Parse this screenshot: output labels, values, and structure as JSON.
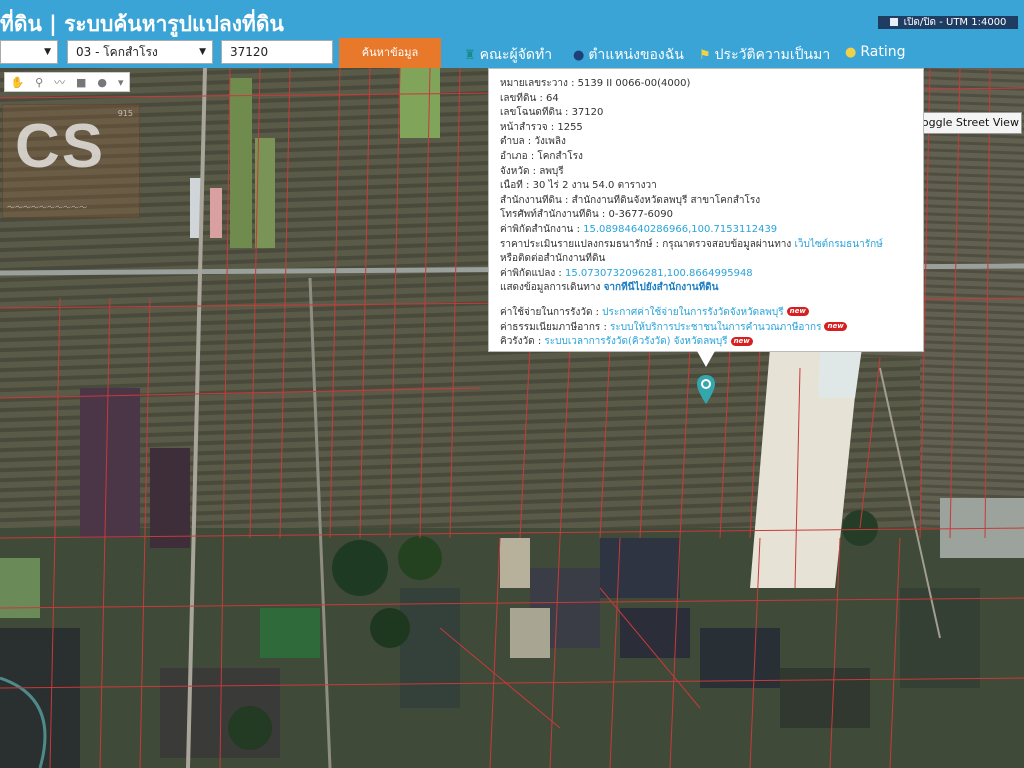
{
  "header": {
    "title": "ที่ดิน | ระบบค้นหารูปแปลงที่ดิน",
    "utm_toggle": "เปิด/ปิด - UTM 1:4000"
  },
  "search": {
    "province_value": "",
    "district_value": "03 - โคกสำโรง",
    "parcel_value": "37120",
    "button_label": "ค้นหาข้อมูล"
  },
  "nav": {
    "team": "คณะผู้จัดทำ",
    "location": "ตำแหน่งของฉัน",
    "history": "ประวัติความเป็นมา",
    "rating": "Rating"
  },
  "toolbar": {
    "icons": [
      "hand-icon",
      "pin-icon",
      "polyline-icon",
      "square-icon",
      "circle-icon",
      "funnel-icon"
    ]
  },
  "watermark": {
    "text": "CS",
    "tag": "915"
  },
  "street_view": {
    "label": "Toggle Street View"
  },
  "popup": {
    "map_sheet_label": "หมายเลขระวาง",
    "map_sheet_value": "5139 II 0066-00(4000)",
    "parcel_no_label": "เลขที่ดิน",
    "parcel_no_value": "64",
    "deed_no_label": "เลขโฉนดที่ดิน",
    "deed_no_value": "37120",
    "survey_page_label": "หน้าสำรวจ",
    "survey_page_value": "1255",
    "subdistrict_label": "ตำบล",
    "subdistrict_value": "วังเพลิง",
    "district_label": "อำเภอ",
    "district_value": "โคกสำโรง",
    "province_label": "จังหวัด",
    "province_value": "ลพบุรี",
    "area_label": "เนื้อที่",
    "area_value": "30 ไร่ 2 งาน 54.0 ตารางวา",
    "office_label": "สำนักงานที่ดิน",
    "office_value": "สำนักงานที่ดินจังหวัดลพบุรี สาขาโคกสำโรง",
    "phone_label": "โทรศัพท์สำนักงานที่ดิน",
    "phone_value": "0-3677-6090",
    "office_coord_label": "ค่าพิกัดสำนักงาน",
    "office_coord_value": "15.08984640286966,100.7153112439",
    "price_label": "ราคาประเมินรายแปลงกรมธนารักษ์",
    "price_text": "กรุณาตรวจสอบข้อมูลผ่านทาง",
    "price_link": "เว็บไซต์กรมธนารักษ์",
    "price_text2": "หรือติดต่อสำนักงานที่ดิน",
    "parcel_coord_label": "ค่าพิกัดแปลง",
    "parcel_coord_value": "15.0730732096281,100.8664995948",
    "route_label": "แสดงข้อมูลการเดินทาง",
    "route_link": "จากที่นี่ไปยังสำนักงานที่ดิน",
    "fee_label": "ค่าใช้จ่ายในการรังวัด",
    "fee_link": "ประกาศค่าใช้จ่ายในการรังวัดจังหวัดลพบุรี",
    "tax_label": "ค่าธรรมเนียมภาษีอากร",
    "tax_link": "ระบบให้บริการประชาชนในการคำนวณภาษีอากร",
    "queue_label": "คิวรังวัด",
    "queue_link": "ระบบเวลาการรังวัด(คิวรังวัด) จังหวัดลพบุรี",
    "new_badge": "new"
  }
}
